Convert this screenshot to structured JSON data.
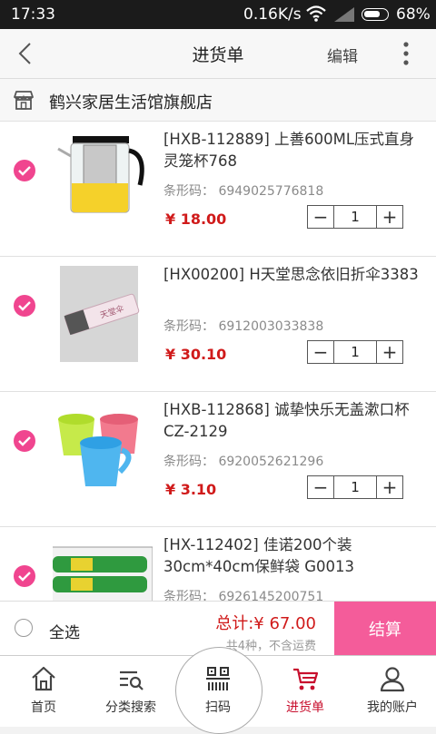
{
  "status_bar": {
    "time": "17:33",
    "network_speed": "0.16K/s",
    "battery": "68%"
  },
  "nav": {
    "title": "进货单",
    "edit_label": "编辑"
  },
  "shop": {
    "name": "鹤兴家居生活馆旗舰店"
  },
  "products": [
    {
      "name": "[HXB-112889] 上善600ML压式直身灵笼杯768",
      "barcode_label": "条形码：",
      "barcode": "6949025776818",
      "price": "¥ 18.00",
      "qty": "1",
      "selected": true,
      "image": "glass-teapot"
    },
    {
      "name": "[HX00200] H天堂思念依旧折伞3383",
      "barcode_label": "条形码：",
      "barcode": "6912003033838",
      "price": "¥ 30.10",
      "qty": "1",
      "selected": true,
      "image": "folding-umbrella"
    },
    {
      "name": "[HXB-112868] 诚挚快乐无盖漱口杯 CZ-2129",
      "barcode_label": "条形码：",
      "barcode": "6920052621296",
      "price": "¥ 3.10",
      "qty": "1",
      "selected": true,
      "image": "plastic-cups"
    },
    {
      "name": "[HX-112402] 佳诺200个装30cm*40cm保鲜袋 G0013",
      "barcode_label": "条形码：",
      "barcode": "6926145200751",
      "price": "",
      "qty": "",
      "selected": true,
      "image": "food-bags"
    }
  ],
  "checkout": {
    "select_all": "全选",
    "total": "总计:¥ 67.00",
    "count_note": "共4种，不含运费",
    "pay_button": "结算"
  },
  "tabs": [
    {
      "label": "首页",
      "icon": "home-icon"
    },
    {
      "label": "分类搜索",
      "icon": "category-search-icon"
    },
    {
      "label": "扫码",
      "icon": "barcode-scan-icon"
    },
    {
      "label": "进货单",
      "icon": "cart-icon",
      "active": true
    },
    {
      "label": "我的账户",
      "icon": "user-icon"
    }
  ],
  "colors": {
    "accent": "#f0458f",
    "price": "#d01a1a",
    "pay_button": "#f45c9a",
    "active_tab": "#c8102e"
  }
}
